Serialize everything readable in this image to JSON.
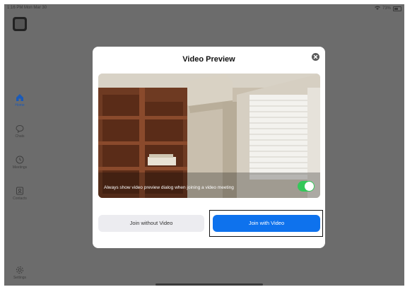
{
  "status_bar": {
    "time": "1:16 PM   Mon Mar 30",
    "battery": "73%"
  },
  "sidebar": {
    "items": [
      {
        "label": "Home",
        "icon": "home-icon"
      },
      {
        "label": "Chats",
        "icon": "chat-icon"
      },
      {
        "label": "Meetings",
        "icon": "clock-icon"
      },
      {
        "label": "Contacts",
        "icon": "contacts-icon"
      },
      {
        "label": "Settings",
        "icon": "gear-icon"
      }
    ]
  },
  "modal": {
    "title": "Video Preview",
    "caption": "Always show video preview dialog when joining a video meeting",
    "toggle_on": true,
    "join_without_video": "Join without Video",
    "join_with_video": "Join with Video"
  },
  "colors": {
    "accent": "#0e72ed",
    "toggle": "#34c759",
    "backdrop": "#6c6c6c"
  }
}
